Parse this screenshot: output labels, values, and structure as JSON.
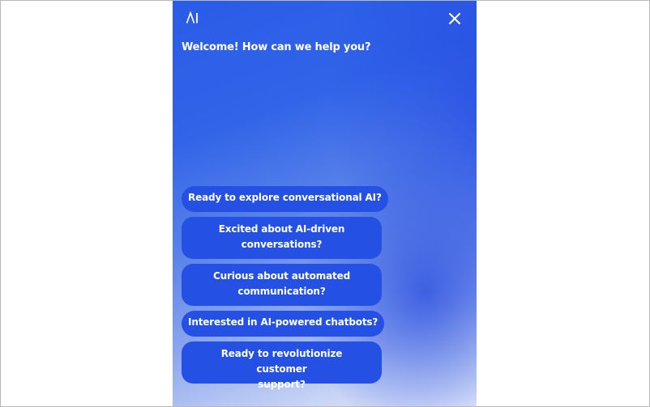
{
  "header": {
    "logo_icon": "ai-logo-icon",
    "close_icon": "close-icon",
    "colors": {
      "panel_blue": "#2a5be7",
      "chip_blue": "#2451e3",
      "text": "#ffffff"
    }
  },
  "chat": {
    "welcome": "Welcome! How can we help you?",
    "suggestions": [
      {
        "line1": "Ready to explore conversational AI?",
        "line2": ""
      },
      {
        "line1": "Excited about AI-driven",
        "line2": "conversations?"
      },
      {
        "line1": "Curious about automated",
        "line2": "communication?"
      },
      {
        "line1": "Interested in AI-powered chatbots?",
        "line2": ""
      },
      {
        "line1": "Ready to revolutionize customer",
        "line2": "support?"
      }
    ]
  }
}
